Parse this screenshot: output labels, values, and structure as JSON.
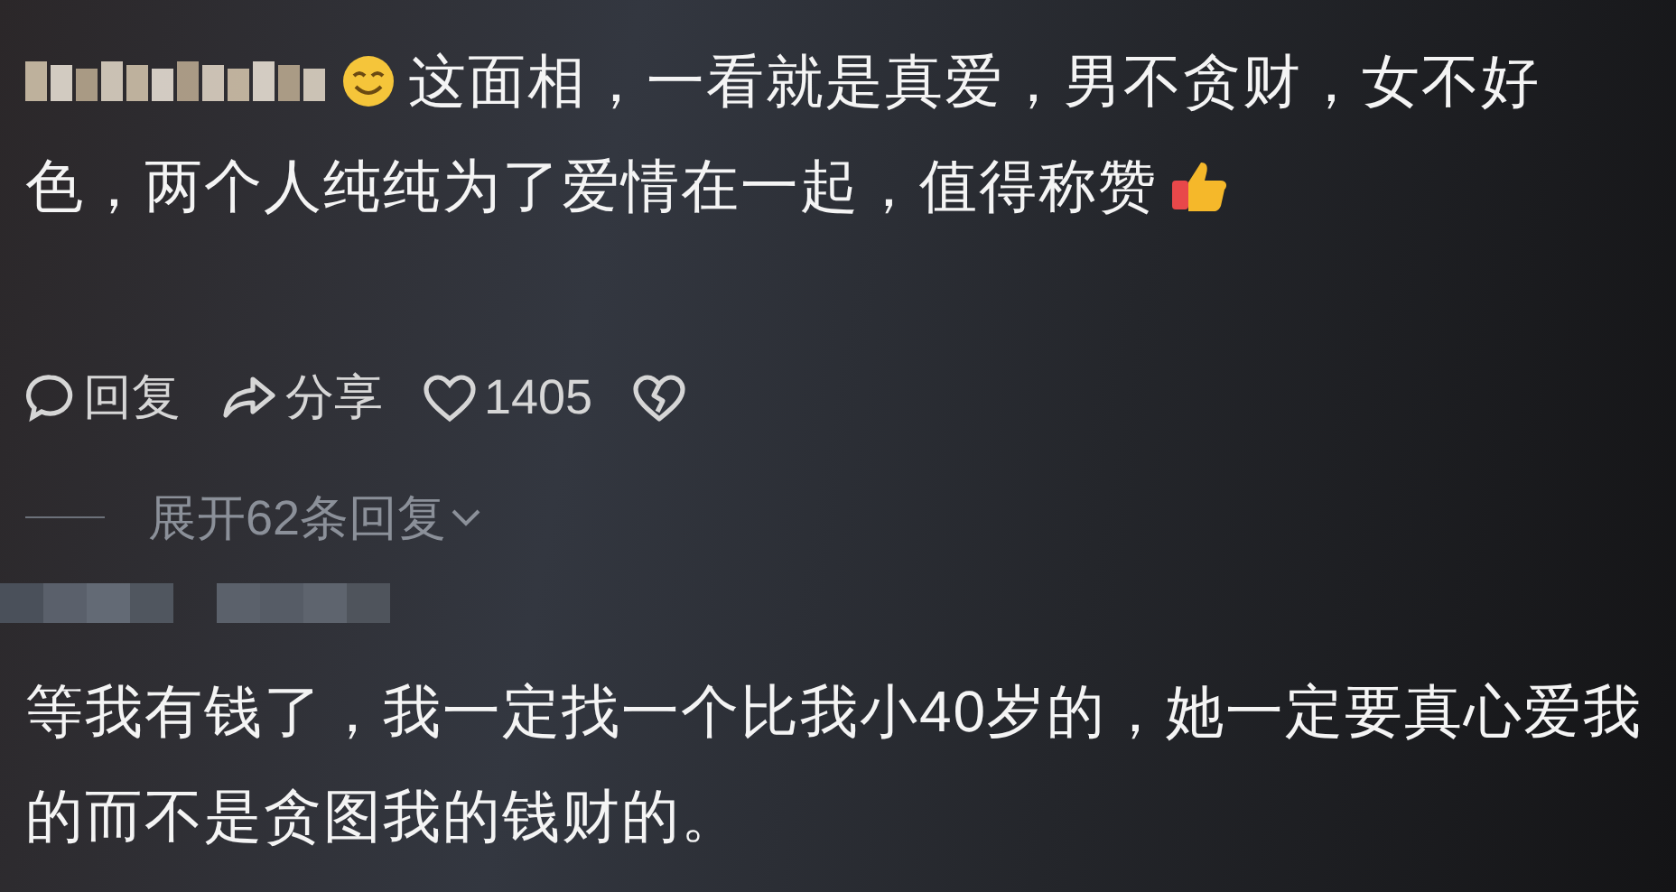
{
  "comments": [
    {
      "lines": [
        "这面相，一看就是真爱，男不贪财，女不好",
        "色，两个人纯纯为了爱情在一起，值得称赞"
      ],
      "actions": [
        {
          "kind": "reply",
          "label": "回复"
        },
        {
          "kind": "share",
          "label": "分享"
        },
        {
          "kind": "like",
          "label": "1405"
        },
        {
          "kind": "dislike"
        }
      ],
      "expand": "展开62条回复"
    },
    {
      "lines": [
        "等我有钱了，我一定找一个比我小40岁的，她一定要真心爱我",
        "的而不是贪图我的钱财的。"
      ]
    }
  ]
}
